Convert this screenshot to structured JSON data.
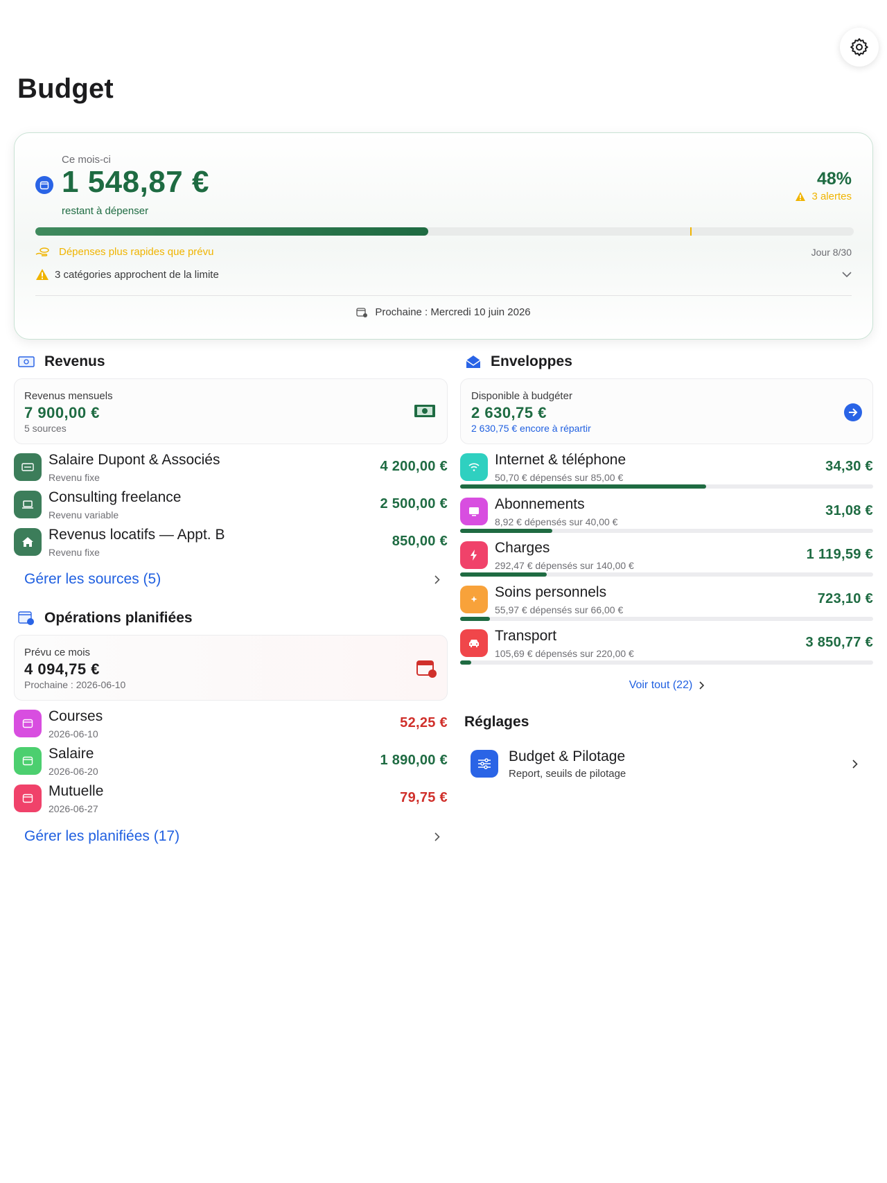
{
  "page": {
    "title": "Budget"
  },
  "hero": {
    "period": "Ce mois-ci",
    "amount": "1 548,87 €",
    "subtitle": "restant à dépenser",
    "percent": "48%",
    "alerts": "3 alertes",
    "progress_fraction": 0.48,
    "day_marker_fraction": 0.8,
    "warning_fast": "Dépenses plus rapides que prévu",
    "day": "Jour 8/30",
    "warning_limit": "3 catégories approchent de la limite",
    "next": "Prochaine : Mercredi 10 juin 2026"
  },
  "revenus": {
    "title": "Revenus",
    "summary_label": "Revenus mensuels",
    "summary_amount": "7 900,00 €",
    "summary_sub": "5 sources",
    "items": [
      {
        "title": "Salaire Dupont & Associés",
        "sub": "Revenu fixe",
        "amount": "4 200,00 €",
        "icon": "briefcase-icon"
      },
      {
        "title": "Consulting freelance",
        "sub": "Revenu variable",
        "amount": "2 500,00 €",
        "icon": "laptop-icon"
      },
      {
        "title": "Revenus locatifs — Appt. B",
        "sub": "Revenu fixe",
        "amount": "850,00 €",
        "icon": "house-icon"
      }
    ],
    "manage": "Gérer les sources (5)"
  },
  "planned": {
    "title": "Opérations planifiées",
    "summary_label": "Prévu ce mois",
    "summary_amount": "4 094,75 €",
    "summary_sub": "Prochaine : 2026-06-10",
    "items": [
      {
        "title": "Courses",
        "sub": "2026-06-10",
        "amount": "52,25 €",
        "color": "#d84ee0"
      },
      {
        "title": "Salaire",
        "sub": "2026-06-20",
        "amount": "1 890,00 €",
        "color": "#4ccf6f"
      },
      {
        "title": "Mutuelle",
        "sub": "2026-06-27",
        "amount": "79,75 €",
        "color": "#f0426a"
      }
    ],
    "manage": "Gérer les planifiées (17)"
  },
  "envelopes": {
    "title": "Enveloppes",
    "summary_label": "Disponible à budgéter",
    "summary_amount": "2 630,75 €",
    "summary_sub": "2 630,75 € encore à répartir",
    "items": [
      {
        "title": "Internet & téléphone",
        "sub": "50,70 € dépensés sur 85,00 €",
        "amount": "34,30 €",
        "color": "#2fd0c0",
        "icon": "wifi-icon",
        "fill": 0.596
      },
      {
        "title": "Abonnements",
        "sub": "8,92 € dépensés sur 40,00 €",
        "amount": "31,08 €",
        "color": "#d84ee0",
        "icon": "tv-icon",
        "fill": 0.223
      },
      {
        "title": "Charges",
        "sub": "292,47 € dépensés sur 140,00 €",
        "amount": "1 119,59 €",
        "color": "#f0426a",
        "icon": "bolt-icon",
        "fill": 0.209
      },
      {
        "title": "Soins personnels",
        "sub": "55,97 € dépensés sur 66,00 €",
        "amount": "723,10 €",
        "color": "#f8a23a",
        "icon": "sparkle-icon",
        "fill": 0.072
      },
      {
        "title": "Transport",
        "sub": "105,69 € dépensés sur 220,00 €",
        "amount": "3 850,77 €",
        "color": "#f0464a",
        "icon": "car-icon",
        "fill": 0.027
      }
    ],
    "see_all": "Voir tout (22)"
  },
  "settings": {
    "title": "Réglages",
    "item_title": "Budget & Pilotage",
    "item_sub": "Report, seuils de pilotage"
  }
}
